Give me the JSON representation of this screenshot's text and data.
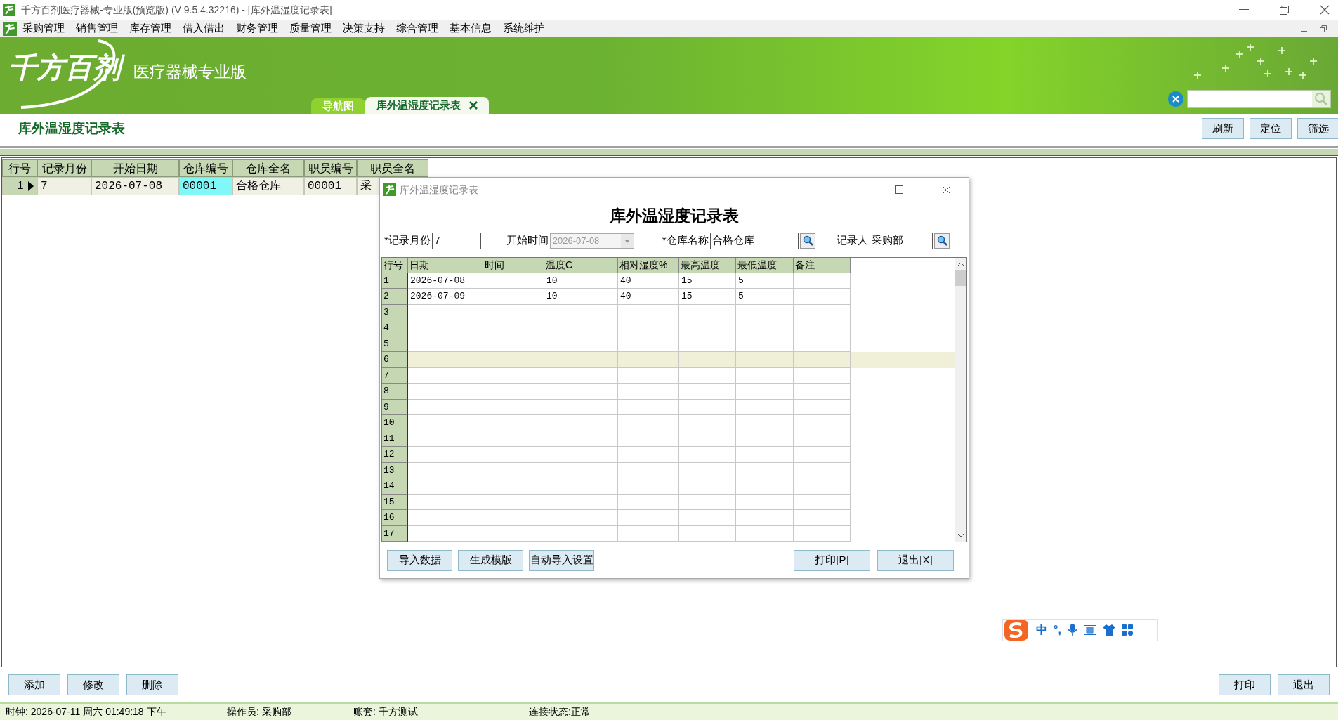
{
  "window": {
    "title": "千方百剂医疗器械-专业版(预览版) (V 9.5.4.32216)   - [库外温湿度记录表]"
  },
  "menu": [
    "采购管理",
    "销售管理",
    "库存管理",
    "借入借出",
    "财务管理",
    "质量管理",
    "决策支持",
    "综合管理",
    "基本信息",
    "系统维护"
  ],
  "banner": {
    "logo": "千方百剂",
    "product": "医疗器械专业版"
  },
  "tabs": [
    {
      "label": "导航图",
      "selected": false
    },
    {
      "label": "库外温湿度记录表",
      "selected": true
    }
  ],
  "page": {
    "title": "库外温湿度记录表",
    "buttons": [
      "刷新",
      "定位",
      "筛选"
    ]
  },
  "main_table": {
    "columns": [
      "行号",
      "记录月份",
      "开始日期",
      "仓库编号",
      "仓库全名",
      "职员编号",
      "职员全名"
    ],
    "rows": [
      {
        "current": true,
        "cells": [
          {
            "text": "1",
            "focused": false
          },
          {
            "text": "7",
            "focused": false
          },
          {
            "text": "2026-07-08",
            "focused": false
          },
          {
            "text": "00001",
            "focused": true
          },
          {
            "text": "合格仓库",
            "focused": false
          },
          {
            "text": "00001",
            "focused": false
          },
          {
            "text": "采",
            "focused": false
          }
        ]
      }
    ]
  },
  "dialog": {
    "title": "库外温湿度记录表",
    "heading": "库外温湿度记录表",
    "fields": [
      {
        "label": "*记录月份",
        "value": "7",
        "kind": "text"
      },
      {
        "label": "开始时间",
        "value": "2026-07-08",
        "kind": "date",
        "disabled": true
      },
      {
        "label": "*仓库名称",
        "value": "合格仓库",
        "kind": "lookup"
      },
      {
        "label": "记录人",
        "value": "采购部",
        "kind": "lookup"
      }
    ],
    "grid": {
      "columns": [
        "行号",
        "日期",
        "时间",
        "温度C",
        "相对湿度%",
        "最高温度",
        "最低温度",
        "备注"
      ],
      "rows": [
        {
          "number": "1",
          "selected": false,
          "cells": [
            "2026-07-08",
            null,
            "10",
            "40",
            "15",
            "5",
            null
          ]
        },
        {
          "number": "2",
          "selected": false,
          "cells": [
            "2026-07-09",
            null,
            "10",
            "40",
            "15",
            "5",
            null
          ]
        },
        {
          "number": "3",
          "selected": false
        },
        {
          "number": "4",
          "selected": false
        },
        {
          "number": "5",
          "selected": false
        },
        {
          "number": "6",
          "selected": true
        },
        {
          "number": "7",
          "selected": false
        },
        {
          "number": "8",
          "selected": false
        },
        {
          "number": "9",
          "selected": false
        },
        {
          "number": "10",
          "selected": false
        },
        {
          "number": "11",
          "selected": false
        },
        {
          "number": "12",
          "selected": false
        },
        {
          "number": "13",
          "selected": false
        },
        {
          "number": "14",
          "selected": false
        },
        {
          "number": "15",
          "selected": false
        },
        {
          "number": "16",
          "selected": false
        },
        {
          "number": "17",
          "selected": false
        }
      ]
    },
    "buttons_left": [
      "导入数据",
      "生成模版",
      "自动导入设置"
    ],
    "buttons_right": [
      "打印[P]",
      "退出[X]"
    ]
  },
  "ime": {
    "mode": "中",
    "punctuation": "°,"
  },
  "footer": {
    "buttons_left": [
      "添加",
      "修改",
      "删除"
    ],
    "buttons_right": [
      "打印",
      "退出"
    ]
  },
  "status_bar": [
    "时钟: 2026-07-11 周六 01:49:18 下午",
    "操作员: 采购部",
    "账套: 千方测试",
    "连接状态:正常"
  ]
}
